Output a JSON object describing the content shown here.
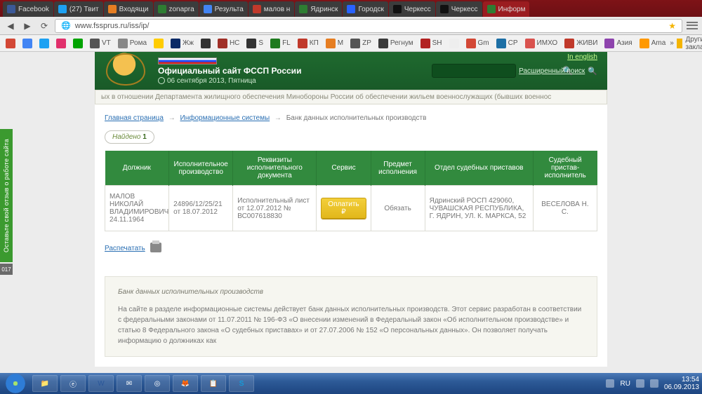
{
  "browser": {
    "tabs": [
      {
        "label": "Facebook",
        "active": false,
        "fav": "fb"
      },
      {
        "label": "(27) Твит",
        "active": false,
        "fav": "tw"
      },
      {
        "label": "Входящи",
        "active": false,
        "fav": "mail"
      },
      {
        "label": "zonapra",
        "active": false,
        "fav": "gn"
      },
      {
        "label": "Результа",
        "active": false,
        "fav": "gg"
      },
      {
        "label": "малов н",
        "active": false,
        "fav": "red"
      },
      {
        "label": "Ядринск",
        "active": false,
        "fav": "gn"
      },
      {
        "label": "Городск",
        "active": false,
        "fav": "bl"
      },
      {
        "label": "Черкесс",
        "active": false,
        "fav": "bk"
      },
      {
        "label": "Черкесс",
        "active": false,
        "fav": "bk"
      },
      {
        "label": "Информ",
        "active": true,
        "fav": "gn"
      }
    ],
    "url": "www.fssprus.ru/iss/ip/",
    "bookmarks": [
      {
        "label": "",
        "color": "#d34836"
      },
      {
        "label": "",
        "color": "#4285f4"
      },
      {
        "label": "",
        "color": "#1da1f2"
      },
      {
        "label": "",
        "color": "#e1306c"
      },
      {
        "label": "",
        "color": "#00a300"
      },
      {
        "label": "VT",
        "color": "#555",
        "text": "VT"
      },
      {
        "label": "",
        "color": "#ffcc00"
      },
      {
        "label": "Жж",
        "color": "#0a2a66",
        "text": "Жж"
      },
      {
        "label": "",
        "color": "#333"
      },
      {
        "label": "HC",
        "color": "#a03028",
        "text": "HC"
      },
      {
        "label": "S",
        "color": "#333",
        "text": "S"
      },
      {
        "label": "FL",
        "color": "#1f7a1f",
        "text": "FL"
      },
      {
        "label": "КП",
        "color": "#c0392b",
        "text": "КП"
      },
      {
        "label": "M",
        "color": "#e67e22",
        "text": "M"
      },
      {
        "label": "ZP",
        "color": "#555",
        "text": "ZP"
      },
      {
        "label": "Регнум",
        "color": "#3b3b3b",
        "text": "Регнум"
      },
      {
        "label": "SH",
        "color": "#b22222",
        "text": "SH"
      },
      {
        "label": "",
        "color": "#eee"
      },
      {
        "label": "Gm",
        "color": "#d34836",
        "text": "Gm"
      },
      {
        "label": "СР",
        "color": "#1d6fa5",
        "text": "СР"
      },
      {
        "label": "ИМХО",
        "color": "#d9534f",
        "text": "ИМХО"
      },
      {
        "label": "ЖИВИ",
        "color": "#c0392b",
        "text": "ЖИВИ"
      },
      {
        "label": "Азия",
        "color": "#8e44ad",
        "text": "Азия"
      },
      {
        "label": "Ama",
        "color": "#ff9900",
        "text": "Ama"
      }
    ],
    "more_bookmarks": "Другие закладки",
    "bm_rome": "Рома"
  },
  "header": {
    "title": "Официальный сайт ФССП России",
    "date": "06 сентября 2013, Пятница",
    "lang_link": "In english",
    "adv_search": "Расширенный поиск"
  },
  "ticker": "ых в отношении Департамента жилищного обеспечения Минобороны России об обеспечении жильем военнослужащих (бывших военнос",
  "breadcrumbs": {
    "home": "Главная страница",
    "systems": "Информационные системы",
    "current": "Банк данных исполнительных производств"
  },
  "found": {
    "label": "Найдено",
    "count": "1"
  },
  "columns": {
    "c1": "Должник",
    "c2": "Исполнительное производство",
    "c3": "Реквизиты исполнительного документа",
    "c4": "Сервис",
    "c5": "Предмет исполнения",
    "c6": "Отдел судебных приставов",
    "c7": "Судебный пристав-исполнитель"
  },
  "row": {
    "debtor": "МАЛОВ НИКОЛАЙ ВЛАДИМИРОВИЧ 24.11.1964",
    "case": "24896/12/25/21 от 18.07.2012",
    "doc": "Исполнительный лист от 12.07.2012 № ВС007618830",
    "service_btn": "Оплатить ₽",
    "subject": "Обязать",
    "dept": "Ядринский РОСП 429060, ЧУВАШСКАЯ РЕСПУБЛИКА, Г. ЯДРИН, УЛ. К. МАРКСА, 52",
    "officer": "ВЕСЕЛОВА Н. С."
  },
  "print": "Распечатать",
  "info": {
    "title": "Банк данных исполнительных производств",
    "body": "На сайте в разделе информационные системы действует банк данных исполнительных производств. Этот сервис разработан в соответствии с федеральными законами от 11.07.2011 № 196-ФЗ «О внесении изменений в Федеральный закон «Об исполнительном производстве» и статью 8 Федерального закона «О судебных приставах» и от 27.07.2006 № 152 «О персональных данных». Он позволяет получать информацию о должниках как"
  },
  "side": {
    "label": "Оставьте свой отзыв о работе сайта",
    "num": "017"
  },
  "taskbar": {
    "lang": "RU",
    "time": "13:54",
    "date": "06.09.2013"
  }
}
